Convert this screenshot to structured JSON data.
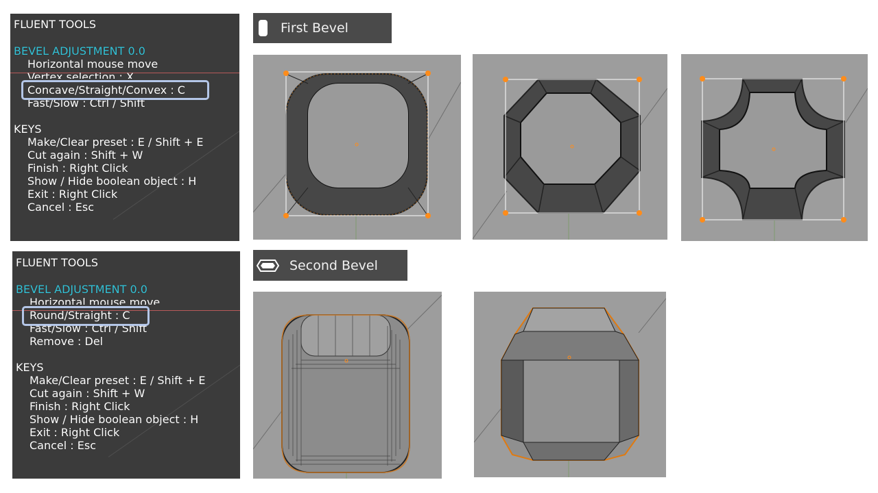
{
  "panel_top": {
    "title": "FLUENT TOOLS",
    "heading": "BEVEL ADJUSTMENT 0.0",
    "items": [
      "Horizontal mouse move",
      "Vertex selection : X",
      "Concave/Straight/Convex : C",
      "Fast/Slow : Ctrl / Shift"
    ],
    "keys_heading": "KEYS",
    "keys": [
      "Make/Clear preset : E / Shift + E",
      "Cut again : Shift + W",
      "Finish : Right Click",
      "Show / Hide boolean object : H",
      "Exit : Right Click",
      "Cancel : Esc"
    ]
  },
  "panel_bottom": {
    "title": "FLUENT TOOLS",
    "heading": "BEVEL ADJUSTMENT 0.0",
    "items": [
      "Horizontal mouse move",
      "Round/Straight : C",
      "Fast/Slow : Ctrl / Shift",
      "Remove : Del"
    ],
    "keys_heading": "KEYS",
    "keys": [
      "Make/Clear preset : E / Shift + E",
      "Cut again : Shift + W",
      "Finish : Right Click",
      "Show / Hide boolean object : H",
      "Exit : Right Click",
      "Cancel : Esc"
    ]
  },
  "labels": {
    "first": "First Bevel",
    "second": "Second Bevel"
  },
  "colors": {
    "panel_bg": "#3b3b3b",
    "heading": "#35c3d8",
    "highlight": "#b4c6e7",
    "viewport_bg": "#9d9d9d",
    "selection": "#ff8c1a"
  },
  "icons": {
    "first": "rounded-rect-icon",
    "second": "hexagon-icon"
  }
}
